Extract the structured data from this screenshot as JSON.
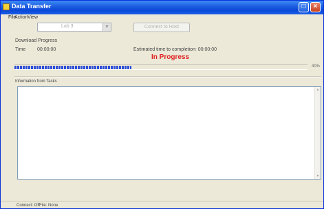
{
  "window": {
    "title": "Data Transfer",
    "maximize_glyph": "□",
    "close_glyph": "×"
  },
  "menu": {
    "items": [
      "File",
      "Action",
      "View"
    ]
  },
  "toolbar": {
    "select_value": "Lab 3",
    "select_arrow": "▼",
    "action_button_label": "Connect to Host"
  },
  "progress": {
    "section_label": "Download Progress",
    "time_label": "Time",
    "time_value": "00:00:00",
    "eta_label": "Estimated time to completion: 00:00:00",
    "status": "In Progress",
    "status_color": "#e02020",
    "bar_color": "#2f4fd8",
    "percent_complete": 40,
    "percent_text": "40%"
  },
  "log": {
    "label": "Information from Tasks",
    "scroll_up_glyph": "▲",
    "scroll_down_glyph": "▼"
  },
  "statusbar": {
    "left": "Connect: Off",
    "right": "File: None"
  },
  "icons": {
    "app": "app-icon",
    "maximize": "maximize-icon",
    "close": "close-icon",
    "dropdown": "chevron-down-icon"
  }
}
